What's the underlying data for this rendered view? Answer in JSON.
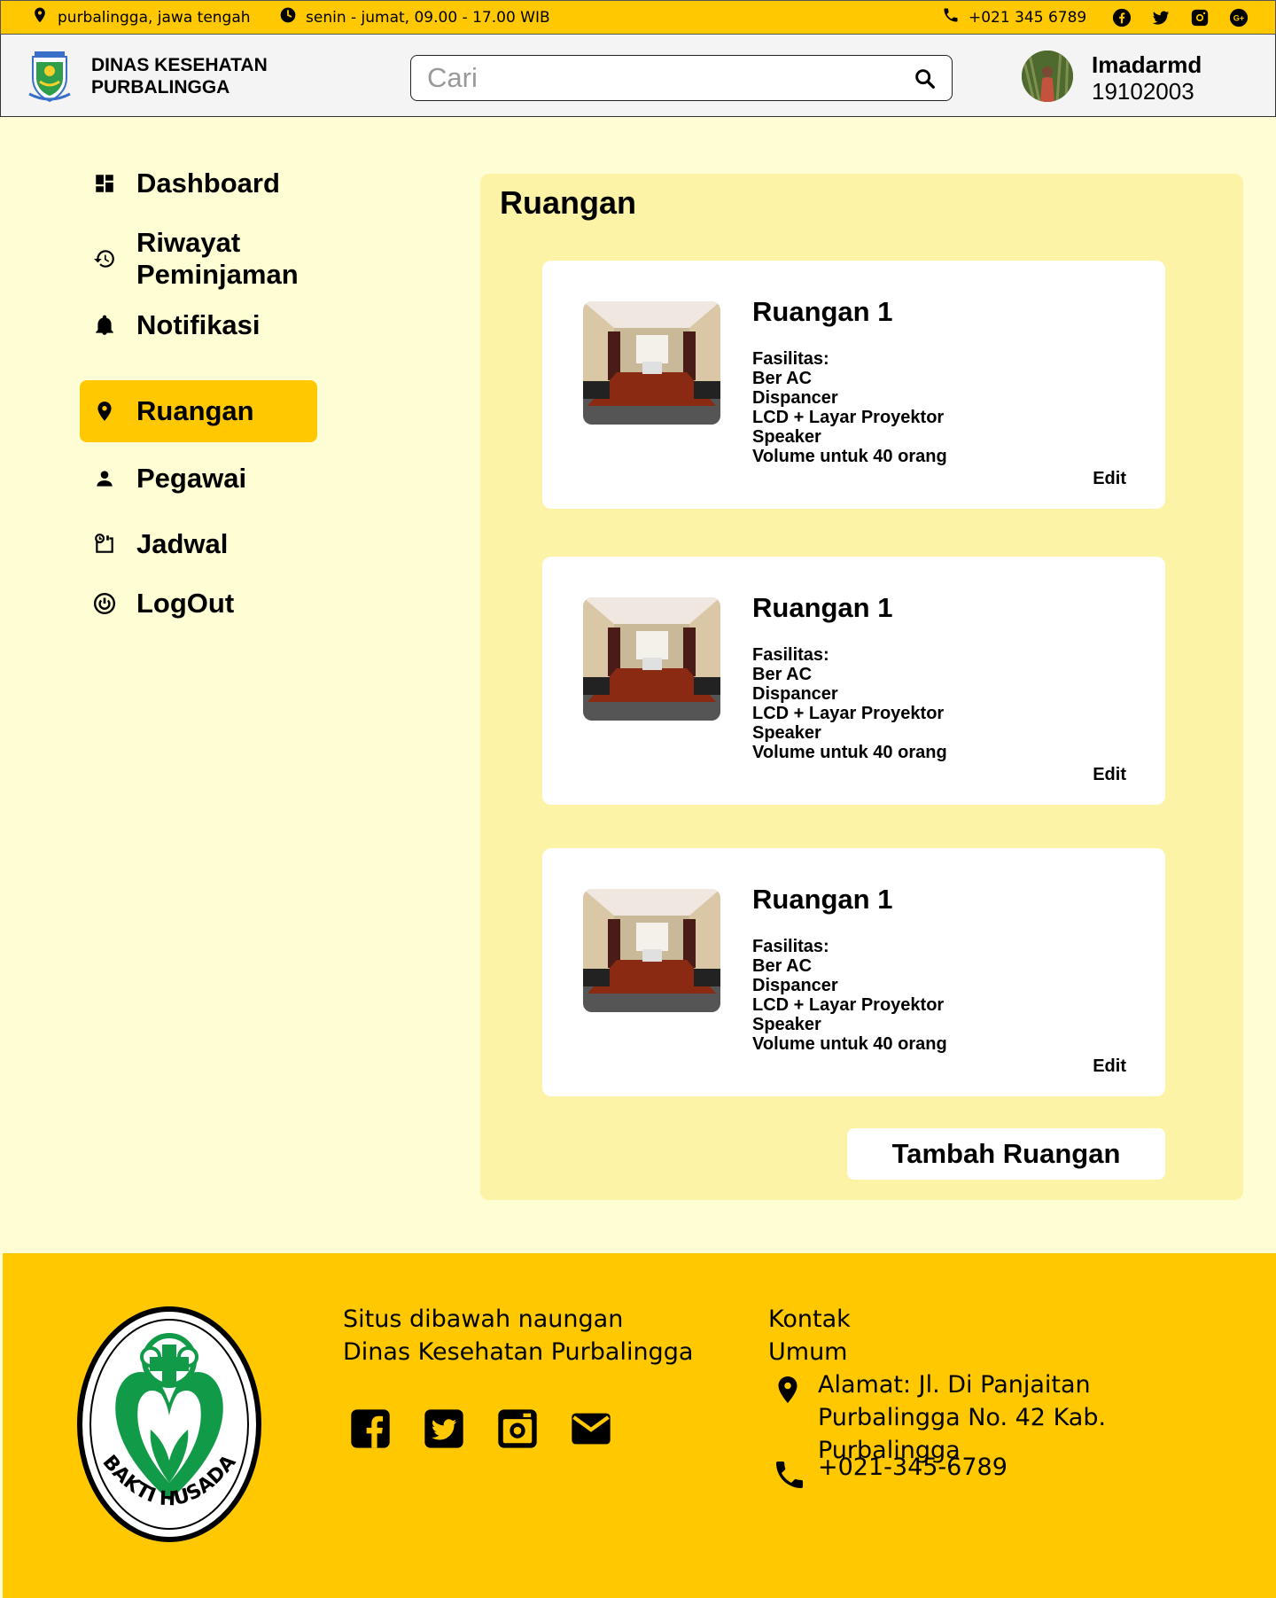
{
  "topbar": {
    "location": "purbalingga,  jawa tengah",
    "hours": "senin - jumat, 09.00 - 17.00 WIB",
    "phone": "+021 345 6789",
    "social_icons": [
      "facebook-icon",
      "twitter-icon",
      "instagram-icon",
      "google-plus-icon"
    ]
  },
  "header": {
    "brand_line1": "DINAS KESEHATAN",
    "brand_line2": "PURBALINGGA",
    "search_placeholder": "Cari",
    "user_name": "Imadarmd",
    "user_id": "19102003"
  },
  "sidebar": {
    "items": [
      {
        "label": "Dashboard",
        "icon": "dashboard-icon",
        "active": false
      },
      {
        "label": "Riwayat Peminjaman",
        "icon": "history-icon",
        "active": false
      },
      {
        "label": "Notifikasi",
        "icon": "bell-icon",
        "active": false
      },
      {
        "label": "Ruangan",
        "icon": "location-pin-icon",
        "active": true
      },
      {
        "label": "Pegawai",
        "icon": "person-icon",
        "active": false
      },
      {
        "label": "Jadwal",
        "icon": "schedule-icon",
        "active": false
      },
      {
        "label": "LogOut",
        "icon": "power-icon",
        "active": false
      }
    ]
  },
  "main": {
    "title": "Ruangan",
    "rooms": [
      {
        "name": "Ruangan 1",
        "facilities": [
          "Fasilitas:",
          "Ber AC",
          "Dispancer",
          "LCD + Layar Proyektor",
          "Speaker",
          "Volume untuk 40 orang"
        ],
        "edit_label": "Edit"
      },
      {
        "name": "Ruangan 1",
        "facilities": [
          "Fasilitas:",
          "Ber AC",
          "Dispancer",
          "LCD + Layar Proyektor",
          "Speaker",
          "Volume untuk 40 orang"
        ],
        "edit_label": "Edit"
      },
      {
        "name": "Ruangan 1",
        "facilities": [
          "Fasilitas:",
          "Ber AC",
          "Dispancer",
          "LCD + Layar Proyektor",
          "Speaker",
          "Volume untuk 40 orang"
        ],
        "edit_label": "Edit"
      }
    ],
    "add_button": "Tambah Ruangan"
  },
  "footer": {
    "logo_text": "BAKTI HUSADA",
    "about": "Situs dibawah naungan Dinas Kesehatan Purbalingga",
    "contact_title": "Kontak Umum",
    "address": "Alamat: Jl. Di Panjaitan Purbalingga No. 42 Kab. Purbalingga",
    "phone": "+021-345-6789",
    "social_icons": [
      "facebook-icon",
      "twitter-icon",
      "instagram-icon",
      "mail-icon"
    ]
  },
  "colors": {
    "accent": "#ffc800",
    "page_bg": "#fffdd3",
    "panel_bg": "#fcf3a6",
    "logo_green": "#119a48"
  }
}
